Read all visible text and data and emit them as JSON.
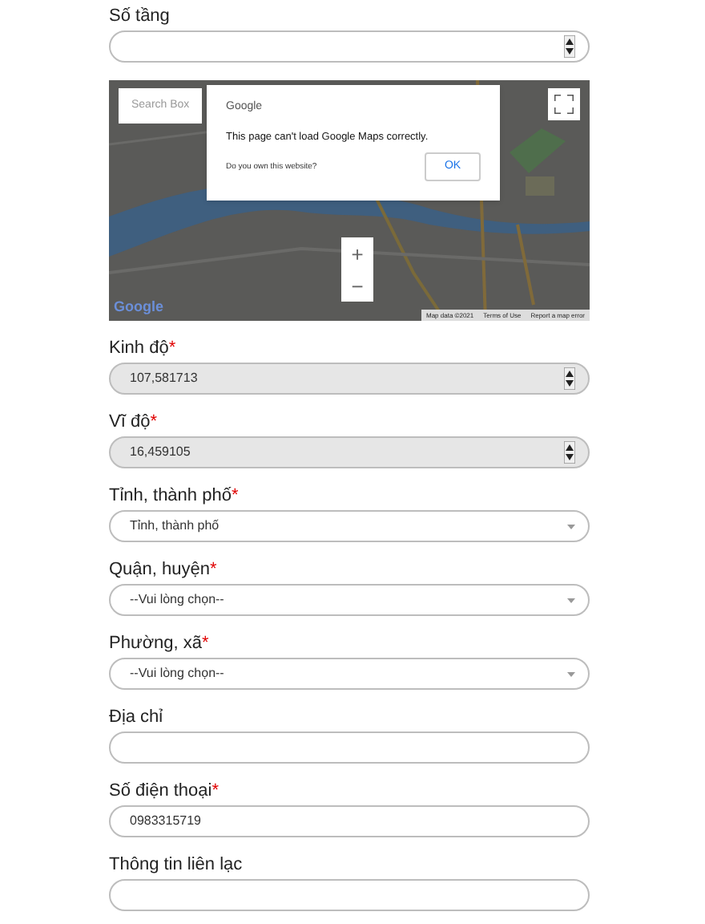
{
  "fields_top": [
    {
      "label": "Số tầng",
      "kind": "number",
      "disabled": false
    }
  ],
  "map": {
    "search": {
      "placeholder": "Search Box"
    },
    "dialog": {
      "brand": "Google",
      "message": "This page can't load Google Maps correctly.",
      "question": "Do you own this website?",
      "button": "OK"
    },
    "zoom_in": "+",
    "zoom_out": "−",
    "logo": "Google",
    "attribution": [
      "Map data ©2021",
      "Terms of Use",
      "Report a map error"
    ]
  },
  "fields": [
    {
      "label": "Kinh độ",
      "mark": "*",
      "kind": "number",
      "value": "107,581713",
      "disabled": true
    },
    {
      "label": "Vĩ độ",
      "mark": "*",
      "kind": "number",
      "value": "16,459105",
      "disabled": true
    },
    {
      "label": "Tỉnh, thành phố",
      "mark": "*",
      "kind": "select",
      "value": "Tỉnh, thành phố",
      "disabled": false
    },
    {
      "label": "Quận, huyện",
      "mark": "*",
      "kind": "select",
      "value": "--Vui lòng chọn--",
      "disabled": false
    },
    {
      "label": "Phường, xã",
      "mark": "*",
      "kind": "select",
      "value": "--Vui lòng chọn--",
      "disabled": false
    },
    {
      "label": "Địa chỉ",
      "kind": "text",
      "disabled": false
    },
    {
      "label": "Số điện thoại",
      "mark": "*",
      "kind": "text",
      "value": "0983315719",
      "disabled": false
    },
    {
      "label": "Thông tin liên lạc",
      "kind": "text",
      "disabled": false
    }
  ]
}
